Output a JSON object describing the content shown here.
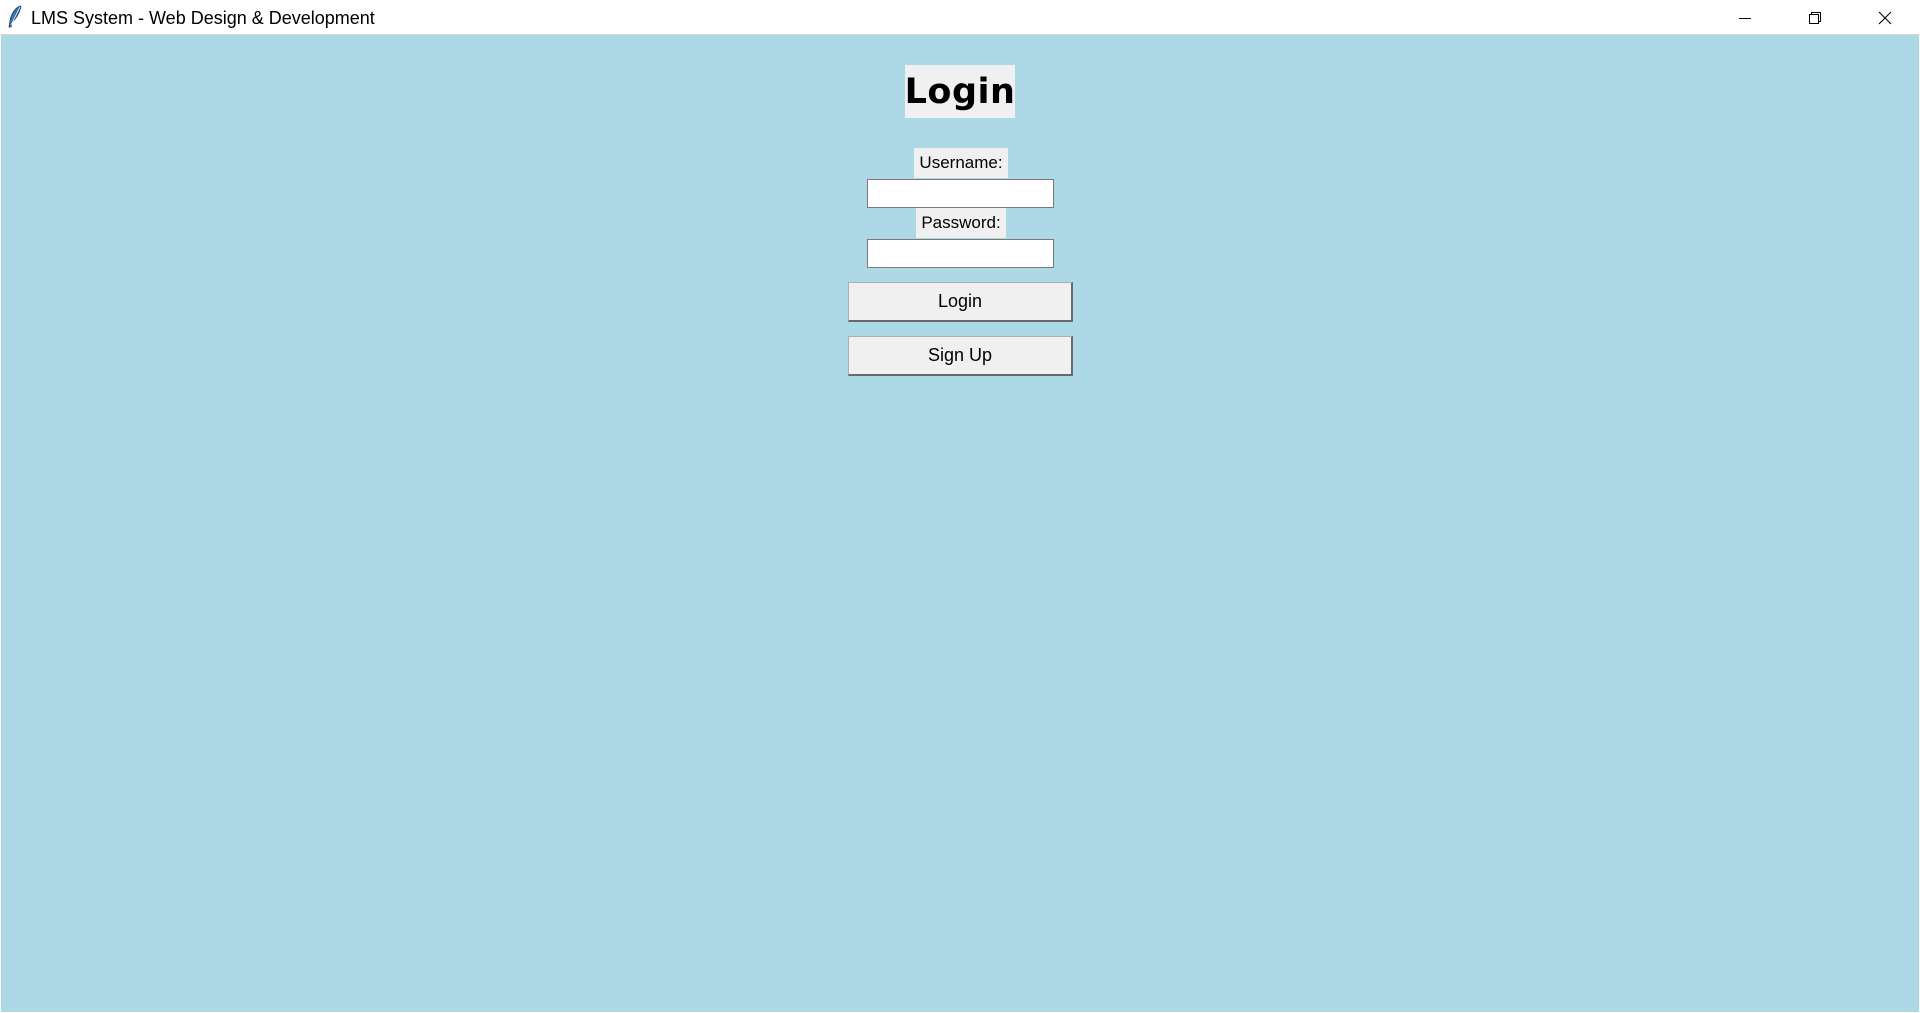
{
  "window": {
    "title": "LMS System - Web Design & Development",
    "app_icon": "tk-feather-icon",
    "controls": {
      "minimize_icon": "minimize-icon",
      "maximize_icon": "restore-icon",
      "close_icon": "close-icon"
    }
  },
  "colors": {
    "background": "#add8e6",
    "widget_background": "#f0f0f0",
    "entry_background": "#ffffff"
  },
  "login_form": {
    "heading": "Login",
    "username_label": "Username:",
    "username_value": "",
    "password_label": "Password:",
    "password_value": "",
    "login_button": "Login",
    "signup_button": "Sign Up"
  }
}
